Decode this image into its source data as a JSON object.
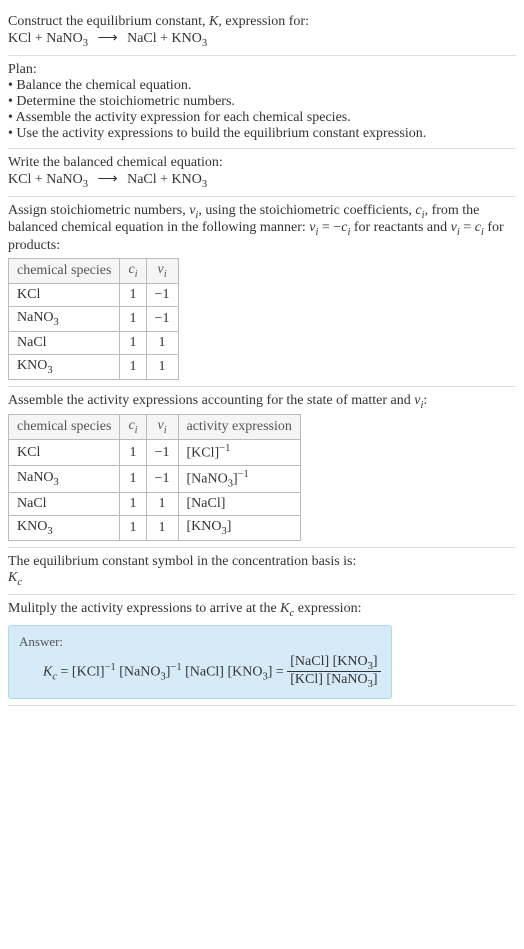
{
  "intro": {
    "line1": "Construct the equilibrium constant, ",
    "K": "K",
    "line1b": ", expression for:",
    "equation_lhs": "KCl + NaNO",
    "equation_rhs": "NaCl + KNO"
  },
  "plan": {
    "title": "Plan:",
    "items": [
      "• Balance the chemical equation.",
      "• Determine the stoichiometric numbers.",
      "• Assemble the activity expression for each chemical species.",
      "• Use the activity expressions to build the equilibrium constant expression."
    ]
  },
  "balanced": {
    "title": "Write the balanced chemical equation:",
    "equation_lhs": "KCl + NaNO",
    "equation_rhs": "NaCl + KNO"
  },
  "stoich": {
    "line1a": "Assign stoichiometric numbers, ",
    "nu": "ν",
    "sub_i": "i",
    "line1b": ", using the stoichiometric coefficients, ",
    "c": "c",
    "line1c": ", from the balanced chemical equation in the following manner: ",
    "eq1a": " = −",
    "line1d": " for reactants and ",
    "eq2a": " = ",
    "line1e": " for products:",
    "headers": {
      "species": "chemical species",
      "ci": "c",
      "nui": "ν"
    },
    "rows": [
      {
        "species": "KCl",
        "ci": "1",
        "nui": "−1"
      },
      {
        "species": "NaNO",
        "species_sub": "3",
        "ci": "1",
        "nui": "−1"
      },
      {
        "species": "NaCl",
        "ci": "1",
        "nui": "1"
      },
      {
        "species": "KNO",
        "species_sub": "3",
        "ci": "1",
        "nui": "1"
      }
    ]
  },
  "activity": {
    "title_a": "Assemble the activity expressions accounting for the state of matter and ",
    "nu": "ν",
    "sub_i": "i",
    "title_b": ":",
    "headers": {
      "species": "chemical species",
      "ci": "c",
      "nui": "ν",
      "expr": "activity expression"
    },
    "rows": [
      {
        "species": "KCl",
        "ci": "1",
        "nui": "−1",
        "expr_base": "[KCl]",
        "expr_exp": "−1"
      },
      {
        "species": "NaNO",
        "species_sub": "3",
        "ci": "1",
        "nui": "−1",
        "expr_base": "[NaNO",
        "expr_sub": "3",
        "expr_close": "]",
        "expr_exp": "−1"
      },
      {
        "species": "NaCl",
        "ci": "1",
        "nui": "1",
        "expr_base": "[NaCl]"
      },
      {
        "species": "KNO",
        "species_sub": "3",
        "ci": "1",
        "nui": "1",
        "expr_base": "[KNO",
        "expr_sub": "3",
        "expr_close": "]"
      }
    ]
  },
  "symbol": {
    "title": "The equilibrium constant symbol in the concentration basis is:",
    "Kc_K": "K",
    "Kc_c": "c"
  },
  "multiply": {
    "title_a": "Mulitply the activity expressions to arrive at the ",
    "Kc_K": "K",
    "Kc_c": "c",
    "title_b": " expression:"
  },
  "answer": {
    "label": "Answer:",
    "Kc_K": "K",
    "Kc_c": "c",
    "eq": " = ",
    "t1": "[KCl]",
    "exp1": "−1",
    "t2a": " [NaNO",
    "t2sub": "3",
    "t2b": "]",
    "exp2": "−1",
    "t3": " [NaCl] [KNO",
    "t3sub": "3",
    "t3b": "] = ",
    "num_a": "[NaCl] [KNO",
    "num_sub": "3",
    "num_b": "]",
    "den_a": "[KCl] [NaNO",
    "den_sub": "3",
    "den_b": "]"
  },
  "arrow": "⟶",
  "three": "3"
}
